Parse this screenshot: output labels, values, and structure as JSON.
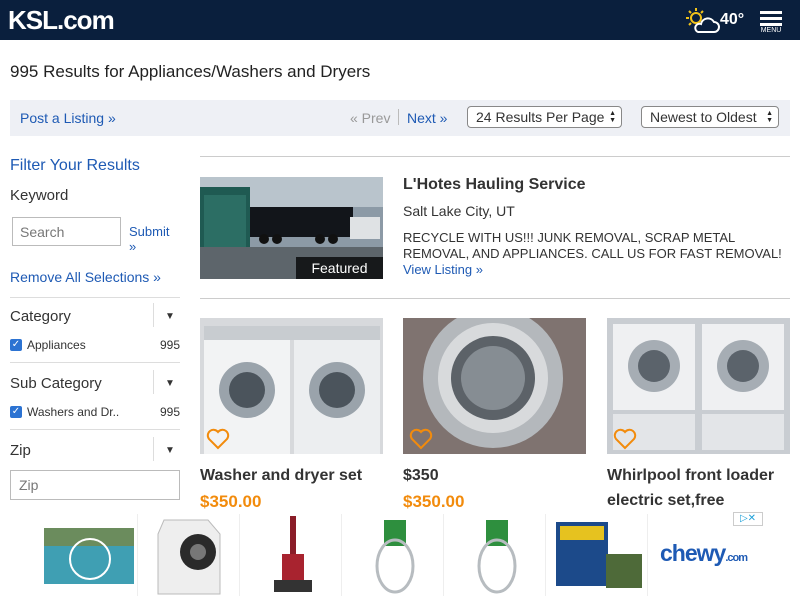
{
  "header": {
    "logo": "KSL.com",
    "temperature": "40°",
    "menu_label": "MENU",
    "weather_icon": "partly-cloudy-icon"
  },
  "page": {
    "results_heading": "995 Results for Appliances/Washers and Dryers"
  },
  "toolbar": {
    "post_listing": "Post a Listing »",
    "prev": "« Prev",
    "next": "Next »",
    "per_page": "24 Results Per Page",
    "sort": "Newest to Oldest"
  },
  "sidebar": {
    "filter_title": "Filter Your Results",
    "keyword_label": "Keyword",
    "search_placeholder": "Search",
    "submit_label": "Submit »",
    "remove_all": "Remove All Selections »",
    "category": {
      "title": "Category",
      "option": "Appliances",
      "count": "995"
    },
    "subcategory": {
      "title": "Sub Category",
      "option": "Washers and Dr..",
      "count": "995"
    },
    "zip": {
      "title": "Zip",
      "placeholder": "Zip"
    }
  },
  "featured": {
    "title": "L'Hotes Hauling Service",
    "location": "Salt Lake City, UT",
    "description": "RECYCLE WITH US!!! JUNK REMOVAL, SCRAP METAL REMOVAL, AND APPLIANCES. CALL US FOR FAST REMOVAL!",
    "link": "View Listing »",
    "badge": "Featured"
  },
  "listings": [
    {
      "title": "Washer and dryer set",
      "price": "$350.00"
    },
    {
      "title": "$350",
      "price": "$350.00"
    },
    {
      "title": "Whirlpool front loader electric set,free",
      "price": ""
    }
  ],
  "ad": {
    "brand": "chewy",
    "brand_suffix": ".com",
    "close": "▷✕"
  },
  "colors": {
    "header_bg": "#0a1f3d",
    "link": "#1e5ab4",
    "price": "#f28b0c"
  }
}
